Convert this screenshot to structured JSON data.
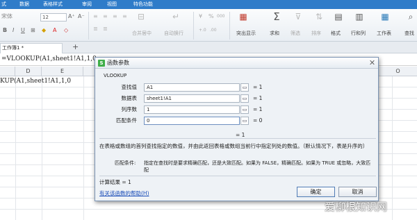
{
  "menubar": {
    "items": [
      "式",
      "数据",
      "表格样式",
      "审阅",
      "视图",
      "特色功能"
    ]
  },
  "ribbon": {
    "font_size": "12",
    "merge_center": "合并居中",
    "auto_wrap": "自动换行",
    "currency": "¥",
    "percent": "%",
    "sep_000": "000",
    "dec_inc": "+.0",
    "dec_dec": ".00",
    "cond_format": "条件格式",
    "table_style": "表格样式",
    "highlight_dup": "突出显示",
    "sum": "求和",
    "filter": "筛选",
    "sort": "排序",
    "format": "格式",
    "rowcol": "行和列",
    "worksheet": "工作表",
    "freeze": "查找"
  },
  "sheet_tab": {
    "label": "工作簿1 *",
    "add": "+"
  },
  "formula_bar": {
    "text": "=VLOOKUP(A1,sheet1!A1,1,0"
  },
  "columns": [
    "D",
    "E",
    "",
    "",
    "",
    "",
    "O"
  ],
  "cell": {
    "text": "KUP(A1,sheet1!A1,1,0"
  },
  "dialog": {
    "title": "函数参数",
    "function_name": "VLOOKUP",
    "args": [
      {
        "label": "查找值",
        "value": "A1",
        "result": "= 1"
      },
      {
        "label": "数据表",
        "value": "sheet1!A1",
        "result": "= 1"
      },
      {
        "label": "列序数",
        "value": "1",
        "result": "= 1"
      },
      {
        "label": "匹配条件",
        "value": "0",
        "result": "= 0"
      }
    ],
    "total_result": "= 1",
    "description": "在表格或数组的首列查找指定的数值，并由此返回表格或数组当前行中指定列处的数值。（默认情况下，表是升序的）",
    "param_name": "匹配条件:",
    "param_desc": "指定在查找时是要求精确匹配，还是大致匹配。如果为 FALSE，精确匹配。如果为 TRUE 或忽略，大致匹配",
    "calc_result": "计算结果 = 1",
    "help_link": "有关该函数的帮助(H)",
    "ok": "确定",
    "cancel": "取消"
  },
  "watermark": "爱柳根知识网"
}
